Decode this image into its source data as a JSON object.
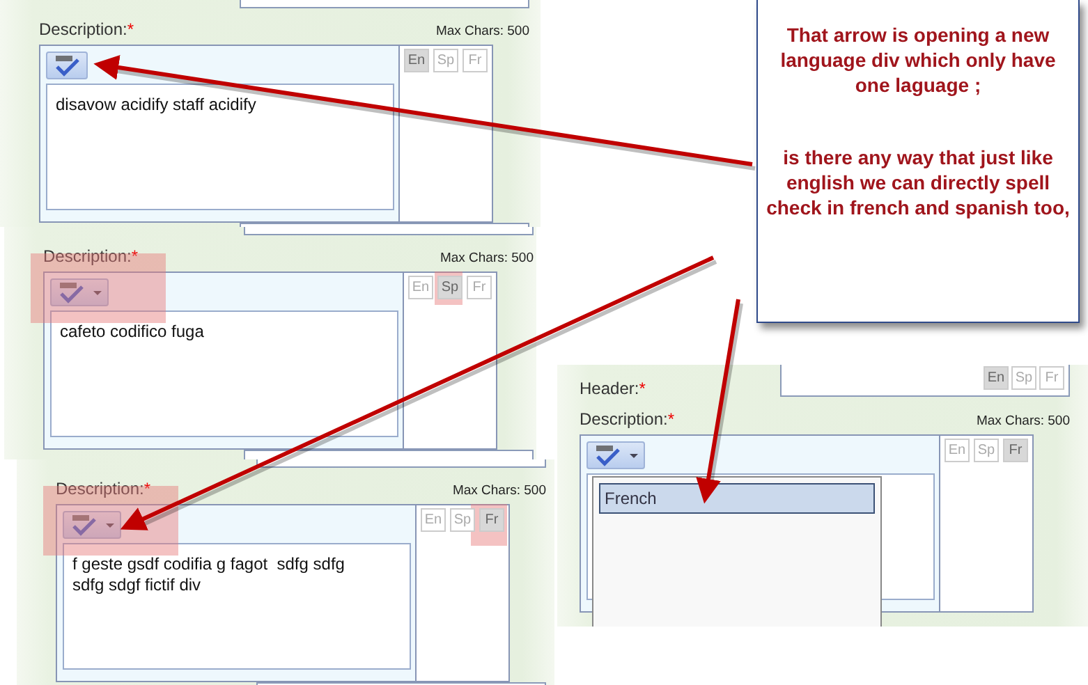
{
  "panels": [
    {
      "kind": "plain",
      "description_label": "Description:",
      "required_mark": "*",
      "max_chars": "Max Chars: 500",
      "spell_button": {
        "has_menu": false,
        "highlighted": false
      },
      "text_lines": [
        "disavow acidify staff acidify"
      ],
      "languages": [
        {
          "label": "En",
          "selected": true,
          "highlighted": false
        },
        {
          "label": "Sp",
          "selected": false,
          "highlighted": false
        },
        {
          "label": "Fr",
          "selected": false,
          "highlighted": false
        }
      ]
    },
    {
      "kind": "plain",
      "description_label": "Description:",
      "required_mark": "*",
      "max_chars": "Max Chars: 500",
      "spell_button": {
        "has_menu": true,
        "highlighted": true
      },
      "text_lines": [
        "cafeto codifico fuga"
      ],
      "languages": [
        {
          "label": "En",
          "selected": false,
          "highlighted": false
        },
        {
          "label": "Sp",
          "selected": true,
          "highlighted": true
        },
        {
          "label": "Fr",
          "selected": false,
          "highlighted": false
        }
      ]
    },
    {
      "kind": "plain",
      "description_label": "Description:",
      "required_mark": "*",
      "max_chars": "Max Chars: 500",
      "spell_button": {
        "has_menu": true,
        "highlighted": true
      },
      "text_lines": [
        "f geste gsdf codifia g fagot  sdfg sdfg",
        "sdfg sdgf fictif div"
      ],
      "languages": [
        {
          "label": "En",
          "selected": false,
          "highlighted": false
        },
        {
          "label": "Sp",
          "selected": false,
          "highlighted": false
        },
        {
          "label": "Fr",
          "selected": true,
          "highlighted": true
        }
      ]
    },
    {
      "kind": "with_header",
      "header_label": "Header:",
      "header_required_mark": "*",
      "header_languages": [
        {
          "label": "En",
          "selected": true
        },
        {
          "label": "Sp",
          "selected": false
        },
        {
          "label": "Fr",
          "selected": false
        }
      ],
      "description_label": "Description:",
      "required_mark": "*",
      "max_chars": "Max Chars: 500",
      "spell_button": {
        "has_menu": true,
        "highlighted": false
      },
      "languages": [
        {
          "label": "En",
          "selected": false,
          "highlighted": false
        },
        {
          "label": "Sp",
          "selected": false,
          "highlighted": false
        },
        {
          "label": "Fr",
          "selected": true,
          "highlighted": false
        }
      ],
      "menu": {
        "items": [
          {
            "label": "French",
            "selected": true
          }
        ]
      }
    }
  ],
  "callout": {
    "paragraphs": [
      "That arrow is opening a new language div which only have one laguage ;",
      "is there any way that just like english we can directly spell check in french and spanish too,"
    ]
  }
}
